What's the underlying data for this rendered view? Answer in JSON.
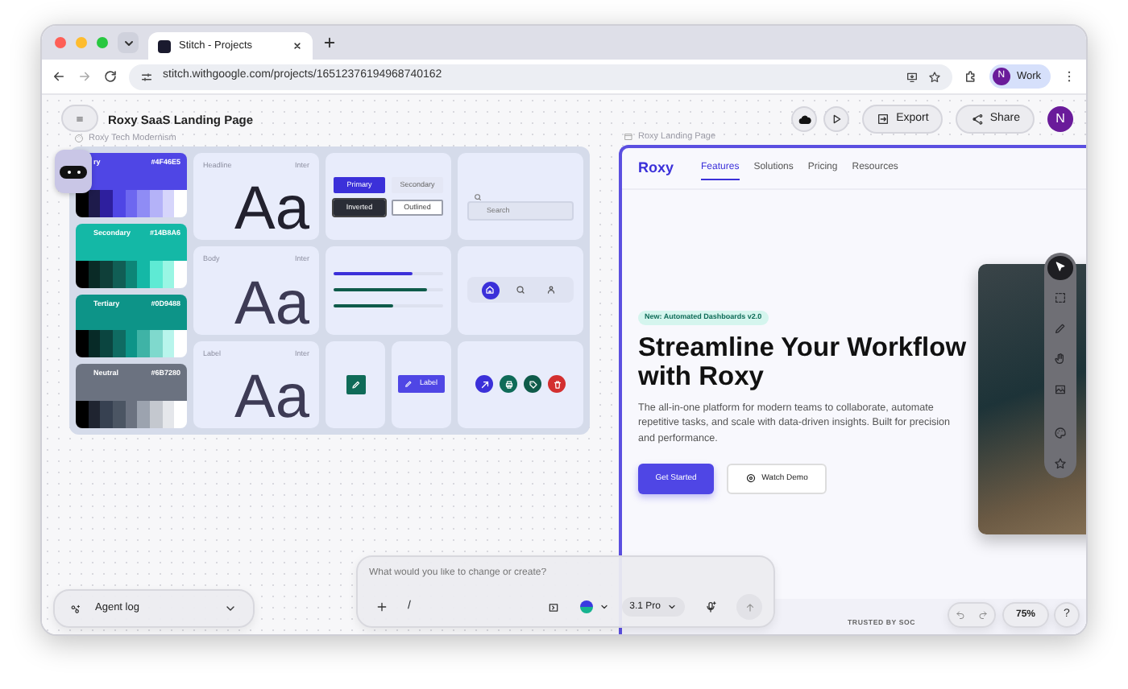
{
  "browser": {
    "tabs": [
      {
        "title": "Stitch - Projects",
        "selected": true
      }
    ],
    "url": "stitch.withgoogle.com/projects/16512376194968740162",
    "profile": {
      "initial": "N",
      "label": "Work"
    }
  },
  "app": {
    "title": "Roxy SaaS Landing Page",
    "actions": [
      {
        "label": "Export",
        "kind": "export"
      },
      {
        "label": "Share",
        "kind": "share"
      }
    ],
    "avatar": "N"
  },
  "design_system": {
    "title": "Roxy Tech Modernism",
    "colors": [
      {
        "name": "ry",
        "hex": "#4F46E5",
        "color": "#4f46e5",
        "shades": [
          {
            "color": "#000000"
          },
          {
            "color": "#1e1b4b"
          },
          {
            "color": "#2e1f9e"
          },
          {
            "color": "#4f46e5"
          },
          {
            "color": "#6d67f0"
          },
          {
            "color": "#8f8cf5"
          },
          {
            "color": "#b4b2f8"
          },
          {
            "color": "#d6d5fb"
          },
          {
            "color": "#ffffff"
          }
        ]
      },
      {
        "name": "Secondary",
        "hex": "#14B8A6",
        "color": "#14b8a6",
        "shades": [
          {
            "color": "#000000"
          },
          {
            "color": "#0a2a26"
          },
          {
            "color": "#0f3f39"
          },
          {
            "color": "#115e55"
          },
          {
            "color": "#0d8577"
          },
          {
            "color": "#14b8a6"
          },
          {
            "color": "#5eead4"
          },
          {
            "color": "#99f6e4"
          },
          {
            "color": "#ffffff"
          }
        ]
      },
      {
        "name": "Tertiary",
        "hex": "#0D9488",
        "color": "#0d9488",
        "shades": [
          {
            "color": "#000000"
          },
          {
            "color": "#072a27"
          },
          {
            "color": "#0b4540"
          },
          {
            "color": "#0f6b62"
          },
          {
            "color": "#0d9488"
          },
          {
            "color": "#3fb3a6"
          },
          {
            "color": "#7fd9cd"
          },
          {
            "color": "#b8f5ec"
          },
          {
            "color": "#ffffff"
          }
        ]
      },
      {
        "name": "Neutral",
        "hex": "#6B7280",
        "color": "#6b7280",
        "shades": [
          {
            "color": "#000000"
          },
          {
            "color": "#1f2430"
          },
          {
            "color": "#374151"
          },
          {
            "color": "#4b5563"
          },
          {
            "color": "#6b7280"
          },
          {
            "color": "#9ca3af"
          },
          {
            "color": "#c4c8cf"
          },
          {
            "color": "#e5e7eb"
          },
          {
            "color": "#ffffff"
          }
        ]
      }
    ],
    "typography": [
      {
        "role": "Headline",
        "font": "Inter",
        "sample": "Aa"
      },
      {
        "role": "Body",
        "font": "Inter",
        "sample": "Aa"
      },
      {
        "role": "Label",
        "font": "Inter",
        "sample": "Aa"
      }
    ],
    "buttons": [
      {
        "label": "Primary",
        "kind": "primary"
      },
      {
        "label": "Secondary",
        "kind": "secondary"
      },
      {
        "label": "Inverted",
        "kind": "inverted"
      },
      {
        "label": "Outlined",
        "kind": "outlined"
      }
    ],
    "search": {
      "placeholder": "Search"
    },
    "progress": [
      {
        "level": 0.72,
        "color": "#3b30d9"
      },
      {
        "level": 0.86,
        "color": "#0f5b4a"
      },
      {
        "level": 0.55,
        "color": "#0f5b4a"
      }
    ],
    "icon_nav": [
      {
        "kind": "home",
        "selected": true
      },
      {
        "kind": "search",
        "selected": false
      },
      {
        "kind": "person",
        "selected": false
      }
    ],
    "label_button": {
      "label": "Label"
    },
    "icon_buttons": [
      {
        "kind": "compass",
        "color": "#3b30d9"
      },
      {
        "kind": "print",
        "color": "#0f6b58"
      },
      {
        "kind": "tag",
        "color": "#0f5b4a"
      },
      {
        "kind": "trash",
        "color": "#d32f2f"
      }
    ]
  },
  "landing": {
    "title": "Roxy Landing Page",
    "brand": "Roxy",
    "nav": [
      {
        "label": "Features",
        "selected": true
      },
      {
        "label": "Solutions",
        "selected": false
      },
      {
        "label": "Pricing",
        "selected": false
      },
      {
        "label": "Resources",
        "selected": false
      }
    ],
    "badge": "New: Automated Dashboards v2.0",
    "headline": "Streamline Your Workflow with Roxy",
    "body": "The all-in-one platform for modern teams to collaborate, automate repetitive tasks, and scale with data-driven insights. Built for precision and performance.",
    "primary_cta": "Get Started",
    "secondary_cta": "Watch Demo",
    "trusted": "TRUSTED BY SOC"
  },
  "tools": [
    {
      "kind": "pointer",
      "selected": true
    },
    {
      "kind": "select",
      "selected": false
    },
    {
      "kind": "pencil",
      "selected": false
    },
    {
      "kind": "hand",
      "selected": false
    },
    {
      "kind": "image",
      "selected": false
    },
    {
      "kind": "palette",
      "selected": false
    },
    {
      "kind": "star",
      "selected": false
    }
  ],
  "agent_log": {
    "label": "Agent log"
  },
  "prompt": {
    "placeholder": "What would you like to change or create?",
    "slash": "/",
    "model": "3.1 Pro"
  },
  "zoom": {
    "label": "75%"
  },
  "help": "?"
}
